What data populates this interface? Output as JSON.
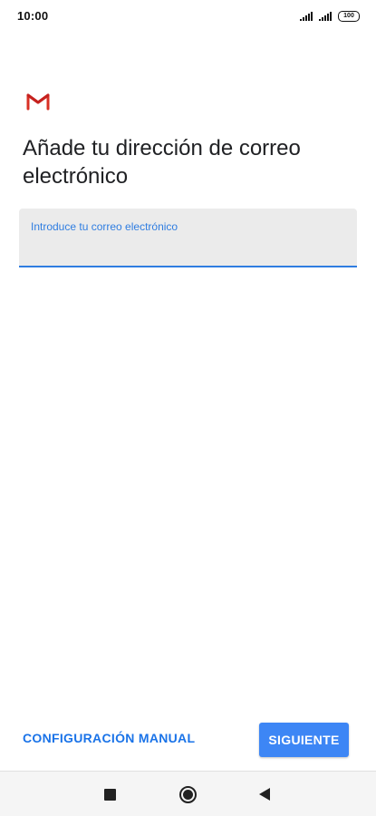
{
  "status_bar": {
    "time": "10:00",
    "battery_level": "100",
    "signal_icons": [
      "signal-icon",
      "signal-icon"
    ],
    "battery_icon": "battery-icon"
  },
  "app": {
    "logo_icon": "gmail-logo-icon",
    "brand_colors": {
      "gmail_red": "#d93025",
      "accent_blue": "#1a73e8",
      "button_blue": "#3d86f5"
    }
  },
  "main": {
    "title": "Añade tu dirección de correo electrónico",
    "email_field": {
      "label": "Introduce tu correo electrónico",
      "value": "",
      "placeholder": ""
    }
  },
  "actions": {
    "manual_setup_label": "CONFIGURACIÓN MANUAL",
    "next_label": "SIGUIENTE"
  },
  "nav_bar": {
    "recents_icon": "square-recents-icon",
    "home_icon": "circle-home-icon",
    "back_icon": "triangle-back-icon"
  }
}
